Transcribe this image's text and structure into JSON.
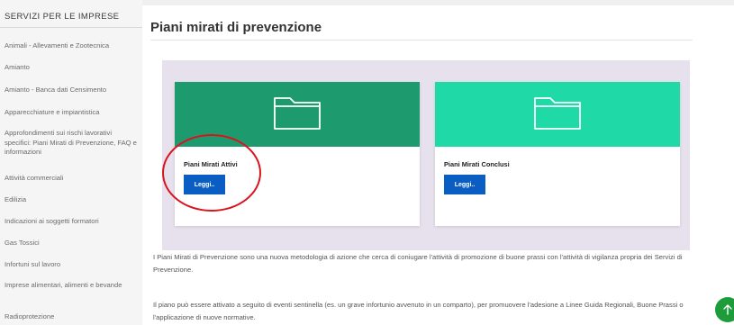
{
  "sidebar": {
    "header": "SERVIZI PER LE IMPRESE",
    "items": [
      {
        "label": "Animali - Allevamenti e Zootecnica"
      },
      {
        "label": "Amianto"
      },
      {
        "label": "Amianto - Banca dati Censimento"
      },
      {
        "label": "Apparecchiature e impiantistica"
      },
      {
        "label": "Approfondimenti sui rischi lavorativi specifici: Piani Mirati di Prevenzione, FAQ e informazioni"
      },
      {
        "label": "Attività commerciali"
      },
      {
        "label": "Edilizia"
      },
      {
        "label": "Indicazioni ai soggetti formatori"
      },
      {
        "label": "Gas Tossici"
      },
      {
        "label": "Infortuni sul lavoro"
      },
      {
        "label": "Imprese alimentari, alimenti e bevande"
      },
      {
        "label": "Radioprotezione"
      }
    ]
  },
  "main": {
    "title": "Piani mirati di prevenzione",
    "cards": [
      {
        "title": "Piani Mirati Attivi",
        "button": "Leggi..",
        "color": "#1e9a6f",
        "icon": "folder-icon"
      },
      {
        "title": "Piani Mirati Conclusi",
        "button": "Leggi..",
        "color": "#1fd9a6",
        "icon": "folder-icon"
      }
    ],
    "paragraphs": [
      "I Piani Mirati di Prevenzione sono una nuova metodologia di azione che cerca di coniugare l'attività di promozione di buone prassi con l'attività di vigilanza propria dei Servizi di Prevenzione.",
      "Il piano può essere attivato a seguito di eventi sentinella (es. un grave infortunio avvenuto in un comparto), per promuovere l'adesione a Linee Guida Regionali, Buone Prassi o l'applicazione di nuove normative."
    ]
  },
  "colors": {
    "button": "#0a5dc2",
    "annotation": "#d9141e",
    "fab": "#1e9b3a",
    "panel": "#e6e1ec"
  },
  "fab": {
    "icon": "arrow-up-icon"
  }
}
